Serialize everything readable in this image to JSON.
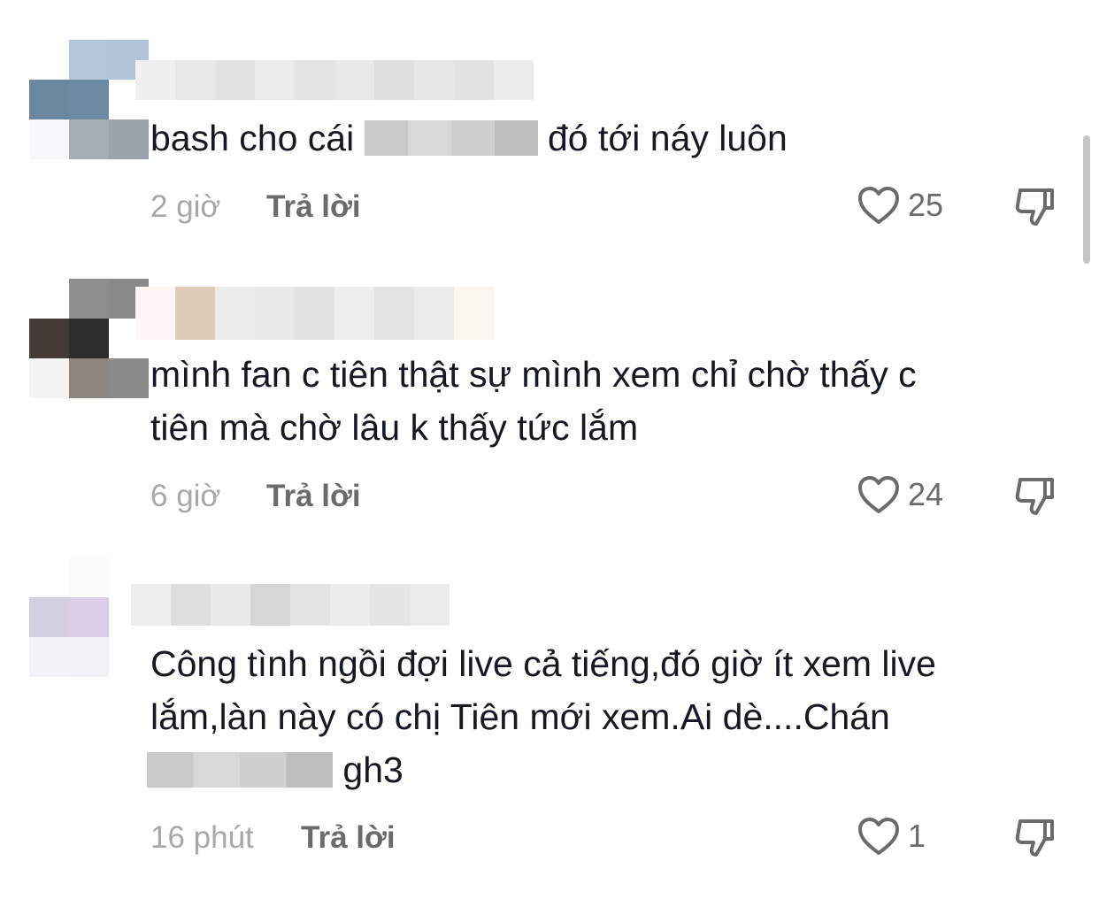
{
  "comments": [
    {
      "text_before": "bash cho cái ",
      "text_after": " đó tới náy luôn",
      "time": "2 giờ",
      "reply_label": "Trả lời",
      "likes": "25"
    },
    {
      "text": "mình fan c tiên thật sự mình xem chỉ chờ thấy c\ntiên mà chờ lâu k thấy tức lắm",
      "time": "6 giờ",
      "reply_label": "Trả lời",
      "likes": "24"
    },
    {
      "text_lines": "Công tình ngồi đợi live cả tiếng,đó giờ ít xem live\nlắm,làn này có chị Tiên mới xem.Ai dè....Chán",
      "text_after": " gh3",
      "time": "16 phút",
      "reply_label": "Trả lời",
      "likes": "1"
    }
  ],
  "icons": {
    "like": "heart-outline-icon",
    "dislike": "thumbs-down-icon"
  },
  "colors": {
    "text": "#161823",
    "meta": "#a8a8a8",
    "reply": "#6b6b6b"
  }
}
